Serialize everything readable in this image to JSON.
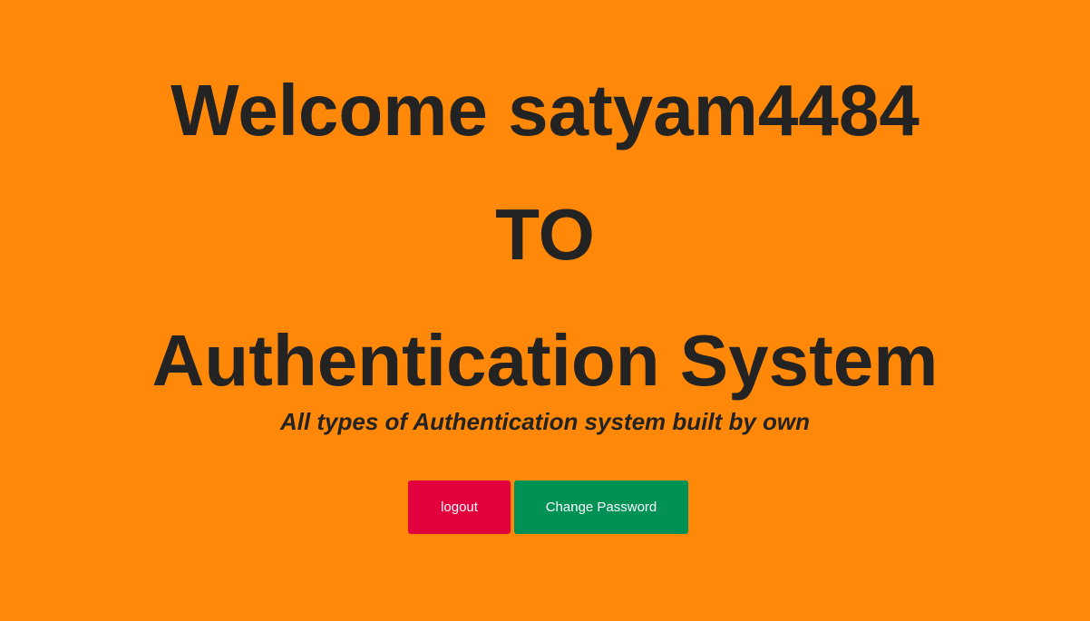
{
  "hero": {
    "welcome_line": "Welcome satyam4484",
    "to_line": "TO",
    "system_line": "Authentication System",
    "tagline": "All types of Authentication system built by own"
  },
  "actions": {
    "logout_label": "logout",
    "change_password_label": "Change Password"
  },
  "colors": {
    "background": "#ff8808",
    "text": "#232323",
    "logout_button": "#e2003d",
    "change_password_button": "#009154"
  }
}
